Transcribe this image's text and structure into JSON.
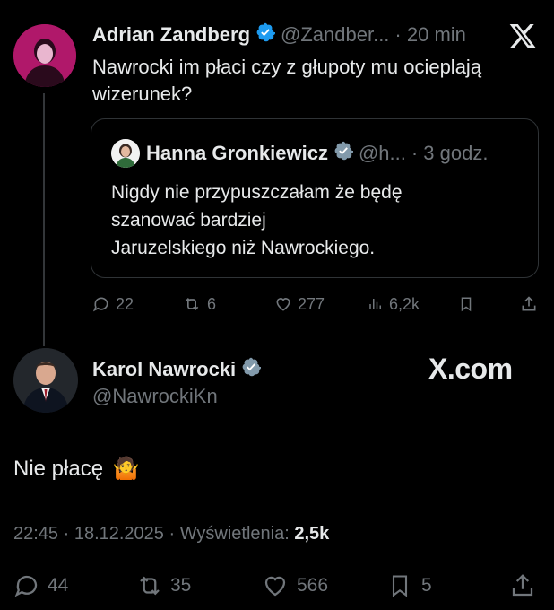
{
  "top_tweet": {
    "author_name": "Adrian Zandberg",
    "handle": "@Zandber...",
    "time": "· 20 min",
    "text_line1": "Nawrocki im płaci czy z głupoty mu ocieplają",
    "text_line2": "wizerunek?",
    "quote": {
      "author_name": "Hanna Gronkiewicz",
      "handle": "@h...",
      "time": "· 3 godz.",
      "line1": "Nigdy nie przypuszczałam że będę",
      "line2": "szanować bardziej",
      "line3": "Jaruzelskiego niż  Nawrockiego."
    },
    "stats": {
      "replies": "22",
      "reposts": "6",
      "likes": "277",
      "views": "6,2k"
    }
  },
  "main_tweet": {
    "author_name": "Karol Nawrocki",
    "handle": "@NawrockiKn",
    "text": "Nie płacę",
    "emoji": "🤷",
    "timestamp": "22:45 · 18.12.2025 · Wyświetlenia:",
    "views_count": "2,5k",
    "stats": {
      "replies": "44",
      "reposts": "35",
      "likes": "566",
      "bookmarks": "5"
    }
  },
  "watermark": "X.com",
  "colors": {
    "background": "#000000",
    "text": "#e7e9ea",
    "muted": "#71767b",
    "verified_blue": "#1d9bf0",
    "verified_gray": "#829aab",
    "border": "#2f3336"
  }
}
